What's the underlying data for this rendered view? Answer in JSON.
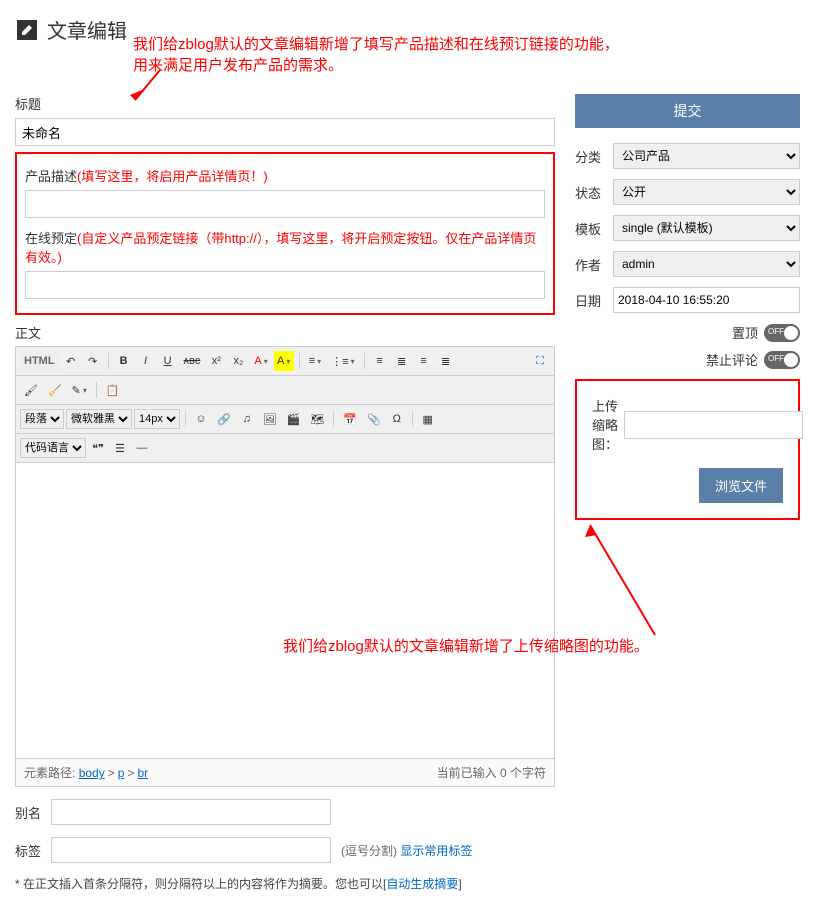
{
  "page_title": "文章编辑",
  "annotations": {
    "top": "我们给zblog默认的文章编辑新增了填写产品描述和在线预订链接的功能，\n用来满足用户发布产品的需求。",
    "bottom": "我们给zblog默认的文章编辑新增了上传缩略图的功能。"
  },
  "title_label": "标题",
  "title_value": "未命名",
  "product_desc_label": "产品描述",
  "product_desc_hint": "(填写这里，将启用产品详情页！)",
  "online_booking_label": "在线预定",
  "online_booking_hint": "(自定义产品预定链接（带http://），填写这里，将开启预定按钮。仅在产品详情页有效。)",
  "body_label": "正文",
  "editor": {
    "html_btn": "HTML",
    "format_select": "段落",
    "font_select": "微软雅黑",
    "size_select": "14px",
    "lang_select": "代码语言",
    "path_prefix": "元素路径:",
    "path1": "body",
    "path2": "p",
    "path3": "br",
    "word_count": "当前已输入 0 个字符"
  },
  "alias": {
    "label": "别名"
  },
  "tags": {
    "label": "标签",
    "hint": "(逗号分割)",
    "link": "显示常用标签"
  },
  "summary": {
    "text": "* 在正文插入首条分隔符，则分隔符以上的内容将作为摘要。您也可以[",
    "link": "自动生成摘要",
    "suffix": "]"
  },
  "sidebar": {
    "submit": "提交",
    "category": {
      "label": "分类",
      "value": "公司产品"
    },
    "status": {
      "label": "状态",
      "value": "公开"
    },
    "template": {
      "label": "模板",
      "value": "single (默认模板)"
    },
    "author": {
      "label": "作者",
      "value": "admin"
    },
    "date": {
      "label": "日期",
      "value": "2018-04-10 16:55:20"
    },
    "sticky": "置顶",
    "no_comment": "禁止评论",
    "toggle_off": "OFF",
    "thumb_label": "上传缩略图：",
    "browse": "浏览文件"
  }
}
